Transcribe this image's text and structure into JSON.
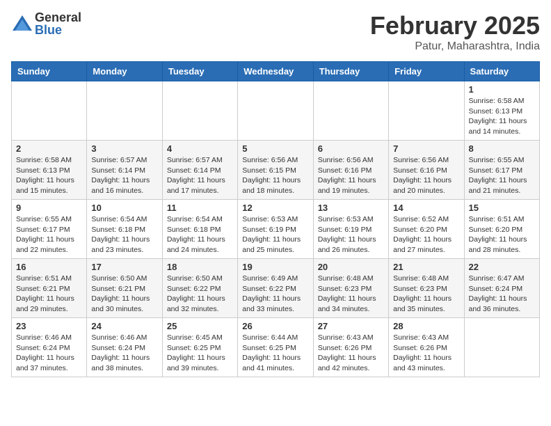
{
  "header": {
    "logo_general": "General",
    "logo_blue": "Blue",
    "month_title": "February 2025",
    "location": "Patur, Maharashtra, India"
  },
  "days_of_week": [
    "Sunday",
    "Monday",
    "Tuesday",
    "Wednesday",
    "Thursday",
    "Friday",
    "Saturday"
  ],
  "weeks": [
    [
      {
        "day": "",
        "info": ""
      },
      {
        "day": "",
        "info": ""
      },
      {
        "day": "",
        "info": ""
      },
      {
        "day": "",
        "info": ""
      },
      {
        "day": "",
        "info": ""
      },
      {
        "day": "",
        "info": ""
      },
      {
        "day": "1",
        "info": "Sunrise: 6:58 AM\nSunset: 6:13 PM\nDaylight: 11 hours\nand 14 minutes."
      }
    ],
    [
      {
        "day": "2",
        "info": "Sunrise: 6:58 AM\nSunset: 6:13 PM\nDaylight: 11 hours\nand 15 minutes."
      },
      {
        "day": "3",
        "info": "Sunrise: 6:57 AM\nSunset: 6:14 PM\nDaylight: 11 hours\nand 16 minutes."
      },
      {
        "day": "4",
        "info": "Sunrise: 6:57 AM\nSunset: 6:14 PM\nDaylight: 11 hours\nand 17 minutes."
      },
      {
        "day": "5",
        "info": "Sunrise: 6:56 AM\nSunset: 6:15 PM\nDaylight: 11 hours\nand 18 minutes."
      },
      {
        "day": "6",
        "info": "Sunrise: 6:56 AM\nSunset: 6:16 PM\nDaylight: 11 hours\nand 19 minutes."
      },
      {
        "day": "7",
        "info": "Sunrise: 6:56 AM\nSunset: 6:16 PM\nDaylight: 11 hours\nand 20 minutes."
      },
      {
        "day": "8",
        "info": "Sunrise: 6:55 AM\nSunset: 6:17 PM\nDaylight: 11 hours\nand 21 minutes."
      }
    ],
    [
      {
        "day": "9",
        "info": "Sunrise: 6:55 AM\nSunset: 6:17 PM\nDaylight: 11 hours\nand 22 minutes."
      },
      {
        "day": "10",
        "info": "Sunrise: 6:54 AM\nSunset: 6:18 PM\nDaylight: 11 hours\nand 23 minutes."
      },
      {
        "day": "11",
        "info": "Sunrise: 6:54 AM\nSunset: 6:18 PM\nDaylight: 11 hours\nand 24 minutes."
      },
      {
        "day": "12",
        "info": "Sunrise: 6:53 AM\nSunset: 6:19 PM\nDaylight: 11 hours\nand 25 minutes."
      },
      {
        "day": "13",
        "info": "Sunrise: 6:53 AM\nSunset: 6:19 PM\nDaylight: 11 hours\nand 26 minutes."
      },
      {
        "day": "14",
        "info": "Sunrise: 6:52 AM\nSunset: 6:20 PM\nDaylight: 11 hours\nand 27 minutes."
      },
      {
        "day": "15",
        "info": "Sunrise: 6:51 AM\nSunset: 6:20 PM\nDaylight: 11 hours\nand 28 minutes."
      }
    ],
    [
      {
        "day": "16",
        "info": "Sunrise: 6:51 AM\nSunset: 6:21 PM\nDaylight: 11 hours\nand 29 minutes."
      },
      {
        "day": "17",
        "info": "Sunrise: 6:50 AM\nSunset: 6:21 PM\nDaylight: 11 hours\nand 30 minutes."
      },
      {
        "day": "18",
        "info": "Sunrise: 6:50 AM\nSunset: 6:22 PM\nDaylight: 11 hours\nand 32 minutes."
      },
      {
        "day": "19",
        "info": "Sunrise: 6:49 AM\nSunset: 6:22 PM\nDaylight: 11 hours\nand 33 minutes."
      },
      {
        "day": "20",
        "info": "Sunrise: 6:48 AM\nSunset: 6:23 PM\nDaylight: 11 hours\nand 34 minutes."
      },
      {
        "day": "21",
        "info": "Sunrise: 6:48 AM\nSunset: 6:23 PM\nDaylight: 11 hours\nand 35 minutes."
      },
      {
        "day": "22",
        "info": "Sunrise: 6:47 AM\nSunset: 6:24 PM\nDaylight: 11 hours\nand 36 minutes."
      }
    ],
    [
      {
        "day": "23",
        "info": "Sunrise: 6:46 AM\nSunset: 6:24 PM\nDaylight: 11 hours\nand 37 minutes."
      },
      {
        "day": "24",
        "info": "Sunrise: 6:46 AM\nSunset: 6:24 PM\nDaylight: 11 hours\nand 38 minutes."
      },
      {
        "day": "25",
        "info": "Sunrise: 6:45 AM\nSunset: 6:25 PM\nDaylight: 11 hours\nand 39 minutes."
      },
      {
        "day": "26",
        "info": "Sunrise: 6:44 AM\nSunset: 6:25 PM\nDaylight: 11 hours\nand 41 minutes."
      },
      {
        "day": "27",
        "info": "Sunrise: 6:43 AM\nSunset: 6:26 PM\nDaylight: 11 hours\nand 42 minutes."
      },
      {
        "day": "28",
        "info": "Sunrise: 6:43 AM\nSunset: 6:26 PM\nDaylight: 11 hours\nand 43 minutes."
      },
      {
        "day": "",
        "info": ""
      }
    ]
  ]
}
